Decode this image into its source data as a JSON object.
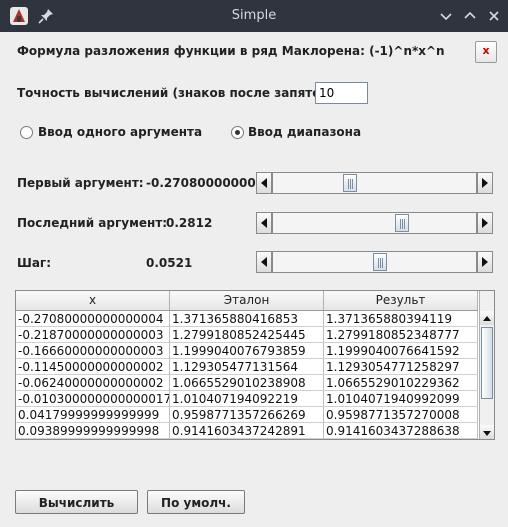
{
  "window": {
    "title": "Simple"
  },
  "formula_label": "Формула разложения функции в ряд Маклорена: (-1)^n*x^n",
  "close_button_label": "x",
  "precision": {
    "label": "Точность вычислений (знаков после запятой):",
    "value": "10"
  },
  "mode": {
    "single_label": "Ввод одного аргумента",
    "range_label": "Ввод диапазона",
    "selected": "range"
  },
  "first_arg": {
    "label": "Первый аргумент:",
    "value": "-0.27080000000..."
  },
  "last_arg": {
    "label": "Последний аргумент:",
    "value": "0.2812"
  },
  "step": {
    "label": "Шаг:",
    "value": "0.0521"
  },
  "table": {
    "headers": [
      "x",
      "Эталон",
      "Результ"
    ],
    "rows": [
      [
        "-0.27080000000000004",
        "1.371365880416853",
        "1.371365880394119"
      ],
      [
        "-0.21870000000000003",
        "1.2799180852425445",
        "1.2799180852348777"
      ],
      [
        "-0.16660000000000003",
        "1.1999040076793859",
        "1.1999040076641592"
      ],
      [
        "-0.11450000000000002",
        "1.129305477131564",
        "1.1293054771258297"
      ],
      [
        "-0.06240000000000002",
        "1.0665529010238908",
        "1.0665529010229362"
      ],
      [
        "-0.010300000000000017",
        "1.010407194092219",
        "1.0104071940992099"
      ],
      [
        "0.04179999999999999",
        "0.9598771357266269",
        "0.9598771357270008"
      ],
      [
        "0.09389999999999998",
        "0.9141603437242891",
        "0.9141603437288638"
      ]
    ]
  },
  "buttons": {
    "calculate": "Вычислить",
    "default": "По умолч."
  }
}
